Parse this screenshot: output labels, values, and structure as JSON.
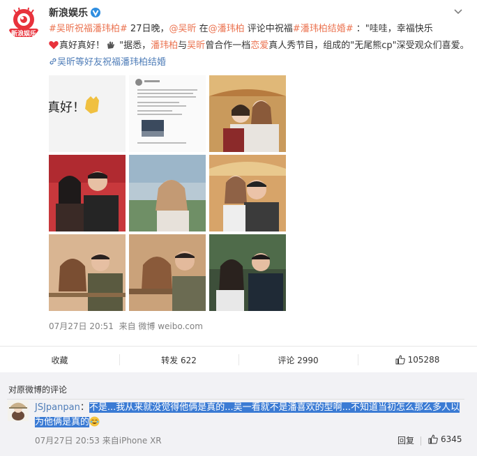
{
  "post": {
    "author": "新浪娱乐",
    "text": {
      "tag1": "#吴昕祝福潘玮柏#",
      "p1": " 27日晚，",
      "mention1": "@吴昕",
      "p2": " 在",
      "mention2": "@潘玮柏",
      "p3": " 评论中祝福",
      "tag2": "#潘玮柏结婚#",
      "p4": " ：\"哇哇，幸福快乐",
      "p5": "真好真好！",
      "p6": " \"据悉，",
      "name1": "潘玮柏",
      "p7": "与",
      "name2": "吴昕",
      "p8": "曾合作一档",
      "word1": "恋爱",
      "p9": "真人秀节目，组成的\"无尾熊cp\"深受观众们喜爱。",
      "link": "吴昕等好友祝福潘玮柏结婚"
    },
    "image_tile1_text": "真好！",
    "timestamp": "07月27日 20:51",
    "source": "来自 微博 weibo.com"
  },
  "actions": {
    "favorite": "收藏",
    "repost": "转发 622",
    "comment": "评论 2990",
    "like": "105288"
  },
  "comments_section": {
    "title": "对原微博的评论",
    "comment": {
      "user": "JSJpanpan",
      "colon": "：",
      "text": "不是...我从来就没觉得他俩是真的...吴一看就不是潘喜欢的型啊...不知道当初怎么那么多人以为他俩是真的",
      "time": "07月27日 20:53 来自iPhone XR",
      "reply": "回复",
      "likes": "6345"
    }
  },
  "colors": {
    "accent": "#eb7350",
    "link": "#4f7db8",
    "highlight": "#3b7bd4"
  }
}
